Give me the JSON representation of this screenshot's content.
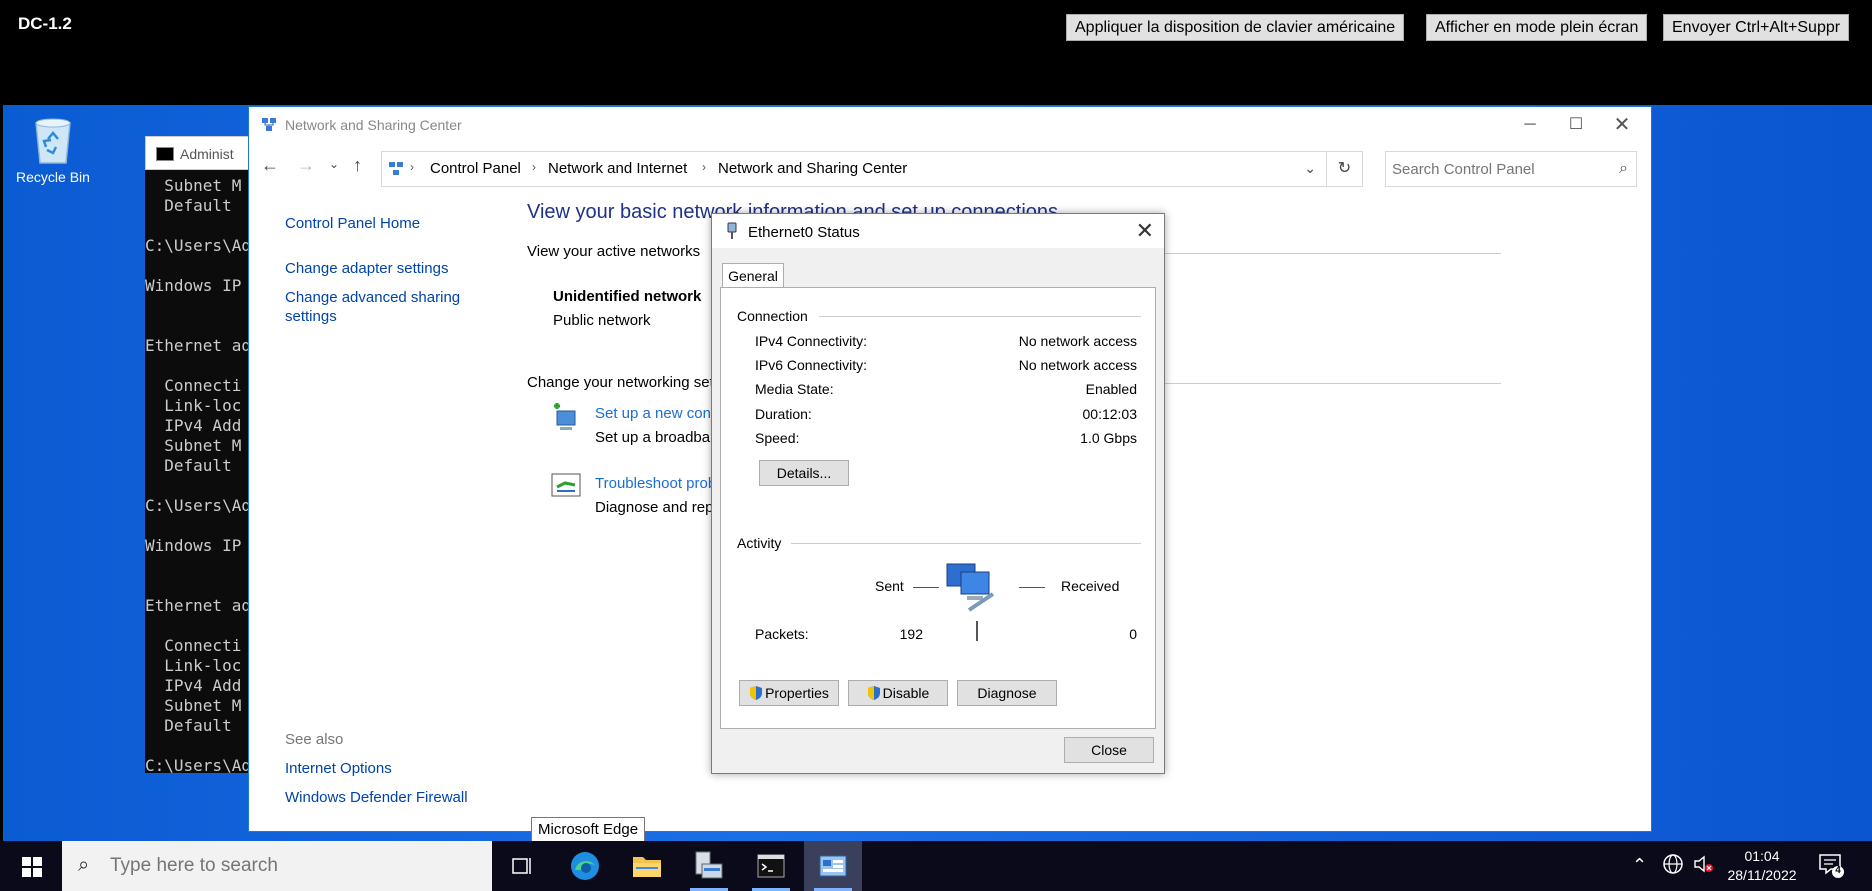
{
  "remote_bar": {
    "session": "DC-1.2",
    "buttons": [
      "Appliquer la disposition de clavier américaine",
      "Afficher en mode plein écran",
      "Envoyer Ctrl+Alt+Suppr"
    ]
  },
  "desktop": {
    "recycle_bin": "Recycle Bin"
  },
  "cmd": {
    "title": "Administ",
    "lines": [
      "  Subnet M",
      "  Default",
      "",
      "C:\\Users\\Ad",
      "",
      "Windows IP",
      "",
      "",
      "Ethernet ad",
      "",
      "  Connecti",
      "  Link-loc",
      "  IPv4 Add",
      "  Subnet M",
      "  Default",
      "",
      "C:\\Users\\Ad",
      "",
      "Windows IP",
      "",
      "",
      "Ethernet ad",
      "",
      "  Connecti",
      "  Link-loc",
      "  IPv4 Add",
      "  Subnet M",
      "  Default",
      "",
      "C:\\Users\\Ad"
    ]
  },
  "explorer": {
    "title": "Network and Sharing Center",
    "breadcrumb": [
      "Control Panel",
      "Network and Internet",
      "Network and Sharing Center"
    ],
    "search_placeholder": "Search Control Panel",
    "sidebar": {
      "home": "Control Panel Home",
      "adapter": "Change adapter settings",
      "advanced_1": "Change advanced sharing",
      "advanced_2": "settings",
      "see_also": "See also",
      "internet_options": "Internet Options",
      "firewall": "Windows Defender Firewall"
    },
    "main": {
      "heading": "View your basic network information and set up connections",
      "active_networks": "View your active networks",
      "network_name": "Unidentified network",
      "network_type": "Public network",
      "change_settings": "Change your networking set",
      "new_conn_link": "Set up a new conn",
      "new_conn_desc": "Set up a broadbar",
      "troubleshoot_link": "Troubleshoot prob",
      "troubleshoot_desc": "Diagnose and rep"
    }
  },
  "status_dialog": {
    "title": "Ethernet0 Status",
    "tab": "General",
    "connection_label": "Connection",
    "rows": [
      {
        "label": "IPv4 Connectivity:",
        "value": "No network access"
      },
      {
        "label": "IPv6 Connectivity:",
        "value": "No network access"
      },
      {
        "label": "Media State:",
        "value": "Enabled"
      },
      {
        "label": "Duration:",
        "value": "00:12:03"
      },
      {
        "label": "Speed:",
        "value": "1.0 Gbps"
      }
    ],
    "details_btn": "Details...",
    "activity_label": "Activity",
    "sent_label": "Sent",
    "received_label": "Received",
    "packets_label": "Packets:",
    "packets_sent": "192",
    "packets_received": "0",
    "properties_btn": "Properties",
    "disable_btn": "Disable",
    "diagnose_btn": "Diagnose",
    "close_btn": "Close"
  },
  "tooltip": "Microsoft Edge",
  "taskbar": {
    "search_placeholder": "Type here to search",
    "time": "01:04",
    "date": "28/11/2022",
    "notification_count": "4"
  }
}
